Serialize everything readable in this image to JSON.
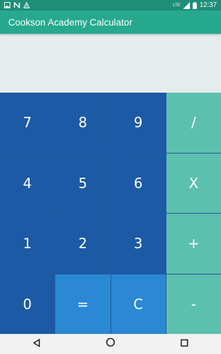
{
  "status_bar": {
    "time": "12:37",
    "network": "LTE",
    "left_icons": [
      "photo-icon",
      "n-icon",
      "a-icon"
    ],
    "right_icons": [
      "signal-icon",
      "battery-icon"
    ]
  },
  "app_bar": {
    "title": "Cookson Academy Calculator"
  },
  "display": {
    "value": ""
  },
  "keypad": {
    "keys": [
      {
        "label": "7",
        "type": "num"
      },
      {
        "label": "8",
        "type": "num"
      },
      {
        "label": "9",
        "type": "num"
      },
      {
        "label": "/",
        "type": "op"
      },
      {
        "label": "4",
        "type": "num"
      },
      {
        "label": "5",
        "type": "num"
      },
      {
        "label": "6",
        "type": "num"
      },
      {
        "label": "X",
        "type": "op"
      },
      {
        "label": "1",
        "type": "num"
      },
      {
        "label": "2",
        "type": "num"
      },
      {
        "label": "3",
        "type": "num"
      },
      {
        "label": "+",
        "type": "op"
      },
      {
        "label": "0",
        "type": "num"
      },
      {
        "label": "=",
        "type": "eq"
      },
      {
        "label": "C",
        "type": "clr"
      },
      {
        "label": "-",
        "type": "op"
      }
    ]
  },
  "nav_bar": {
    "icons": [
      "back-icon",
      "home-icon",
      "recents-icon"
    ]
  },
  "colors": {
    "status_bar": "#1f8f79",
    "app_bar": "#27a98f",
    "display_bg": "#e6eceb",
    "number_key": "#1d5aa6",
    "equals_clear_key": "#2a88d4",
    "operator_key": "#5cc0ae",
    "nav_bar": "#f2f2f2"
  }
}
